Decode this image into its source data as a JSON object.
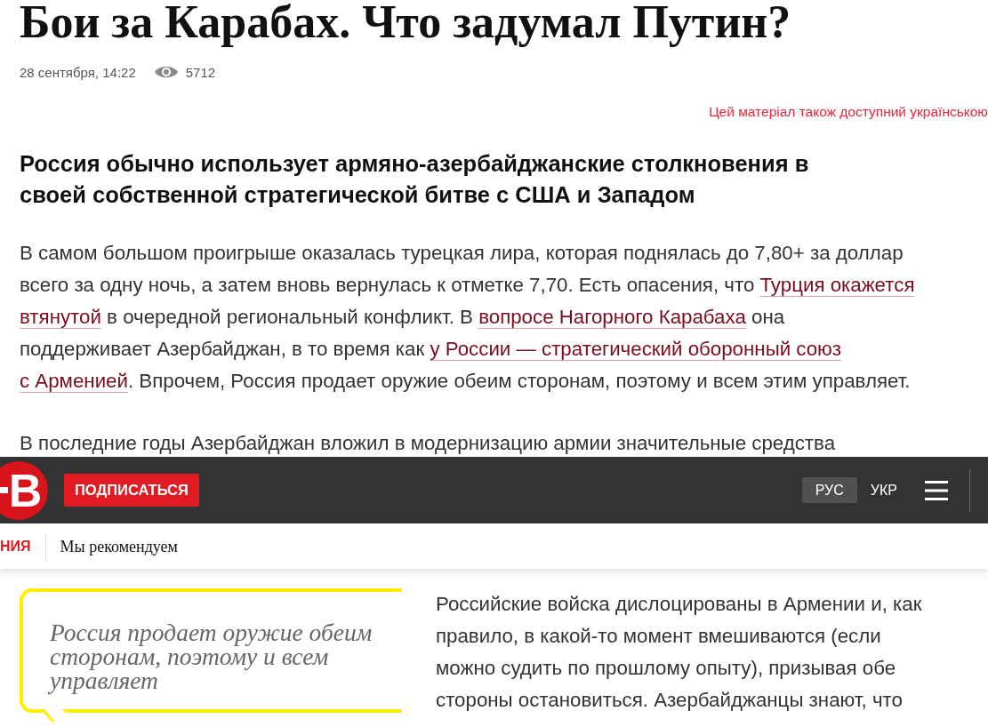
{
  "article": {
    "title": "Бои за Карабах. Что задумал Путин?",
    "date": "28 сентября, 14:22",
    "views": "5712",
    "language_link": "Цей матеріал також доступний українською",
    "subtitle": "Россия обычно использует армяно-азербайджанские столкновения в своей собственной стратегической битве с США и Западом",
    "paragraph_lines": [
      [
        {
          "text": "В самом большом проигрыше оказалась турецкая лира, которая поднялась до 7,80+ за доллар"
        }
      ],
      [
        {
          "text": "всего за одну ночь, а затем вновь вернулась к отметке 7,70. Есть опасения, что "
        },
        {
          "text": "Турция окажется",
          "link": true
        }
      ],
      [
        {
          "text": "втянутой",
          "link": true
        },
        {
          "text": " в очередной региональный конфликт. В "
        },
        {
          "text": "вопросе Нагорного Карабаха",
          "link": true
        },
        {
          "text": " она"
        }
      ],
      [
        {
          "text": "поддерживает Азербайджан, в то время как "
        },
        {
          "text": "у России — стратегический оборонный союз",
          "link": true
        }
      ],
      [
        {
          "text": "с Арменией",
          "link": true
        },
        {
          "text": ". Впрочем, Россия продает оружие обеим сторонам, поэтому и всем этим управляет."
        }
      ]
    ],
    "partial_line": "В последние годы Азербайджан вложил в модернизацию армии значительные средства",
    "quote": "Россия продает оружие обеим сторонам, поэтому и всем управляет",
    "side_lines": [
      "Российские войска дислоцированы в Армении и, как",
      "правило, в какой-то момент вмешиваются (если",
      "можно судить по прошлому опыту), призывая обе",
      "стороны остановиться. Азербайджанцы знают, что"
    ]
  },
  "header": {
    "logo": "В",
    "subscribe": "ПОДПИСАТЬСЯ",
    "languages": [
      {
        "label": "РУС",
        "selected": true
      },
      {
        "label": "УКР",
        "selected": false
      }
    ]
  },
  "subnav": [
    {
      "label": "НИЯ",
      "selected": true
    },
    {
      "label": "Мы рекомендуем",
      "selected": false
    }
  ]
}
